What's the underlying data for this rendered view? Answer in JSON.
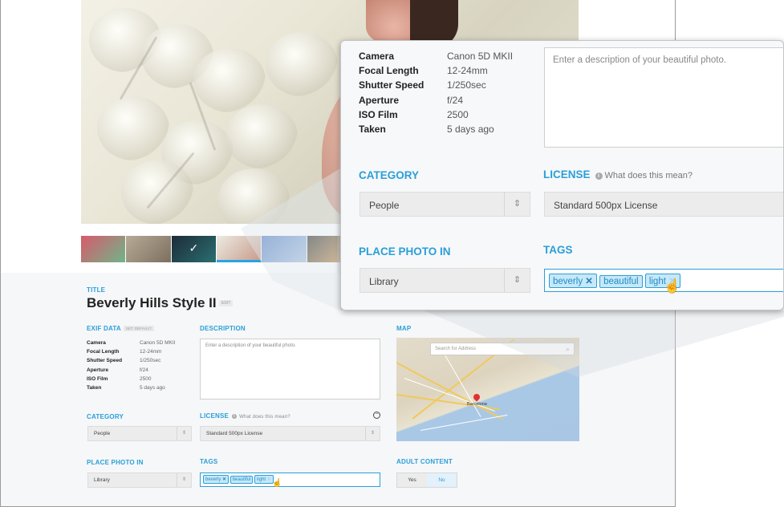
{
  "photo": {
    "title_label": "TITLE",
    "title": "Beverly Hills Style II",
    "edit_label": "EDIT"
  },
  "exif": {
    "label": "EXIF DATA",
    "set_default_label": "SET DEFAULT",
    "rows": [
      {
        "key": "Camera",
        "value": "Canon 5D MKII"
      },
      {
        "key": "Focal Length",
        "value": "12-24mm"
      },
      {
        "key": "Shutter Speed",
        "value": "1/250sec"
      },
      {
        "key": "Aperture",
        "value": "f/24"
      },
      {
        "key": "ISO Film",
        "value": "2500"
      },
      {
        "key": "Taken",
        "value": "5 days ago"
      }
    ]
  },
  "description": {
    "label": "DESCRIPTION",
    "placeholder": "Enter a description of your beautiful photo."
  },
  "map": {
    "label": "MAP",
    "search_placeholder": "Search for Address",
    "city": "Barcelona"
  },
  "category": {
    "label": "CATEGORY",
    "value": "People"
  },
  "license": {
    "label": "LICENSE",
    "help": "What does this mean?",
    "value": "Standard 500px License"
  },
  "place": {
    "label": "PLACE PHOTO IN",
    "value": "Library"
  },
  "tags": {
    "label": "TAGS",
    "items": [
      "beverly",
      "beautiful",
      "light"
    ]
  },
  "adult": {
    "label": "ADULT CONTENT",
    "yes": "Yes",
    "no": "No",
    "selected": "No"
  },
  "colors": {
    "accent": "#2a9fd8",
    "tag_bg": "#c7e8f8",
    "form_bg": "#f6f7f9"
  },
  "icons": {
    "select_arrows": "up-down-arrows-icon",
    "tag_remove": "x-icon",
    "info": "info-icon",
    "search": "search-icon",
    "cursor": "hand-cursor-icon"
  }
}
